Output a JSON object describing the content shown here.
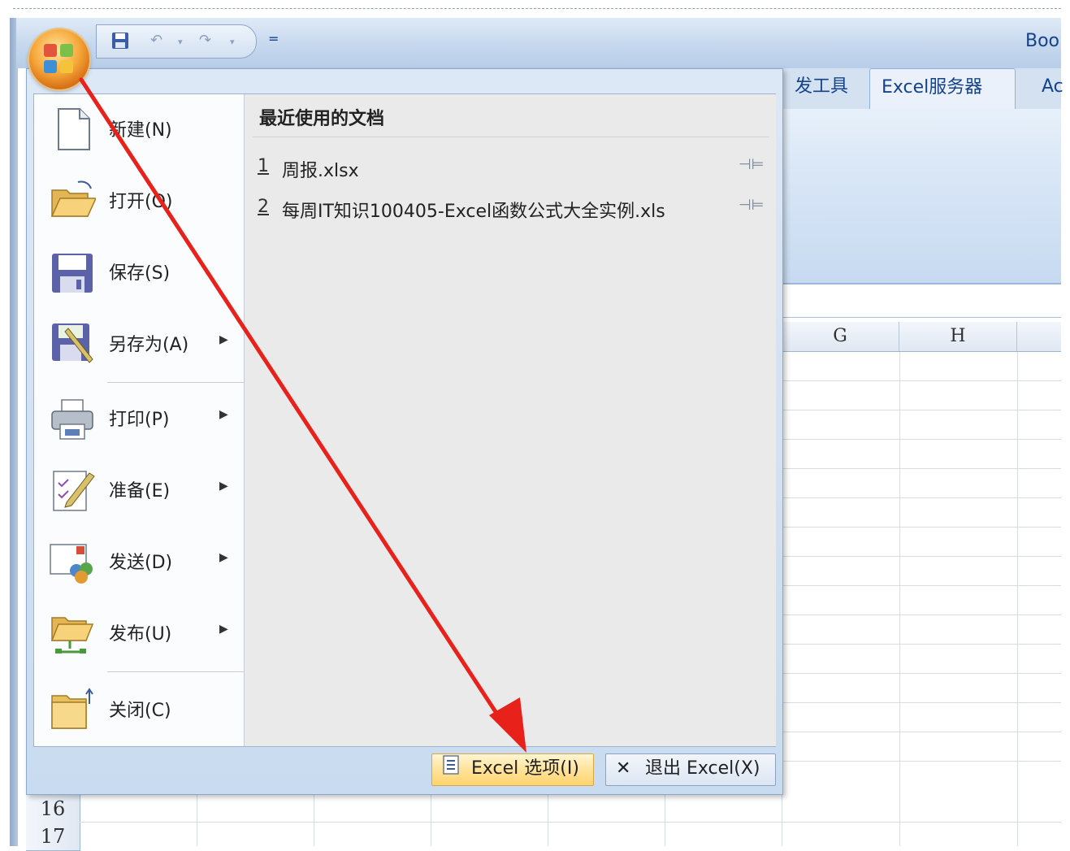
{
  "window": {
    "title": "Boo",
    "quick_access": {
      "save_icon": "save-icon",
      "undo_icon": "undo-icon",
      "redo_icon": "redo-icon",
      "customize_symbol": "="
    }
  },
  "ribbon": {
    "tabs": [
      {
        "label": "发工具"
      },
      {
        "label": "Excel服务器"
      },
      {
        "label": "Ac"
      }
    ],
    "active_tab": "Excel服务器"
  },
  "sheet": {
    "columns": [
      "G",
      "H"
    ],
    "rows": [
      "16",
      "17"
    ]
  },
  "office_menu": {
    "items": [
      {
        "label": "新建(N)",
        "icon": "new-document-icon",
        "submenu": false
      },
      {
        "label": "打开(O)",
        "icon": "open-folder-icon",
        "submenu": false
      },
      {
        "label": "保存(S)",
        "icon": "save-icon",
        "submenu": false
      },
      {
        "label": "另存为(A)",
        "icon": "save-as-icon",
        "submenu": true
      },
      {
        "label": "打印(P)",
        "icon": "printer-icon",
        "submenu": true
      },
      {
        "label": "准备(E)",
        "icon": "prepare-icon",
        "submenu": true
      },
      {
        "label": "发送(D)",
        "icon": "send-icon",
        "submenu": true
      },
      {
        "label": "发布(U)",
        "icon": "publish-icon",
        "submenu": true
      },
      {
        "label": "关闭(C)",
        "icon": "close-folder-icon",
        "submenu": false
      }
    ],
    "recent": {
      "title": "最近使用的文档",
      "files": [
        {
          "num": "1",
          "name": "周报.xlsx"
        },
        {
          "num": "2",
          "name": "每周IT知识100405-Excel函数公式大全实例.xls"
        }
      ]
    },
    "footer": {
      "options_label": "Excel 选项(I)",
      "exit_label": "退出 Excel(X)",
      "exit_icon_glyph": "✕"
    }
  },
  "colors": {
    "accent_blue": "#15428b",
    "annotation_red": "#e8211a",
    "options_highlight": "#ffe29a"
  }
}
